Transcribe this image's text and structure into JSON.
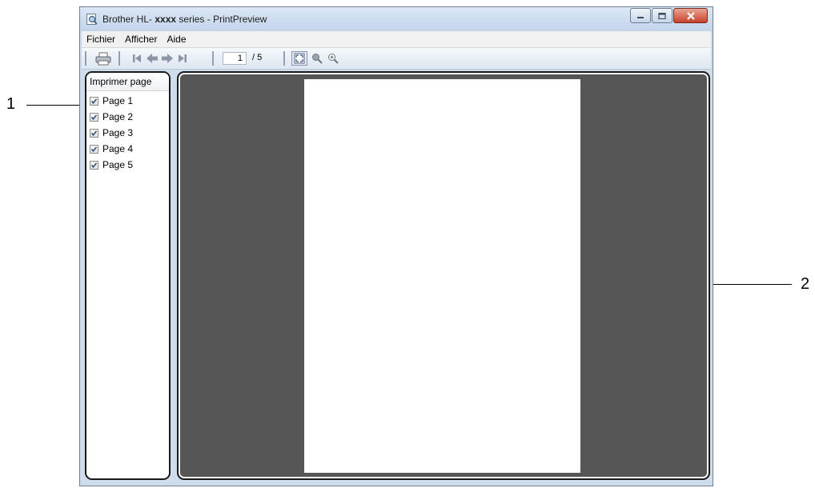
{
  "callouts": {
    "left": "1",
    "right": "2"
  },
  "window": {
    "title_prefix": "Brother HL-",
    "title_bold": "xxxx",
    "title_suffix": " series - PrintPreview",
    "minimize_icon": "minimize-icon",
    "maximize_icon": "maximize-icon",
    "close_icon": "close-icon",
    "close_color": "#c7422a"
  },
  "menu": [
    "Fichier",
    "Afficher",
    "Aide"
  ],
  "toolbar": {
    "current_page": "1",
    "total_pages": "/ 5",
    "icons": [
      "printer-icon",
      "first-page-icon",
      "previous-page-icon",
      "next-page-icon",
      "last-page-icon",
      "fit-page-icon",
      "zoom-out-icon",
      "zoom-in-icon"
    ]
  },
  "sidebar": {
    "header": "Imprimer page",
    "pages": [
      {
        "label": "Page 1",
        "checked": true
      },
      {
        "label": "Page 2",
        "checked": true
      },
      {
        "label": "Page 3",
        "checked": true
      },
      {
        "label": "Page 4",
        "checked": true
      },
      {
        "label": "Page 5",
        "checked": true
      }
    ]
  },
  "preview": {
    "background": "#565656"
  }
}
